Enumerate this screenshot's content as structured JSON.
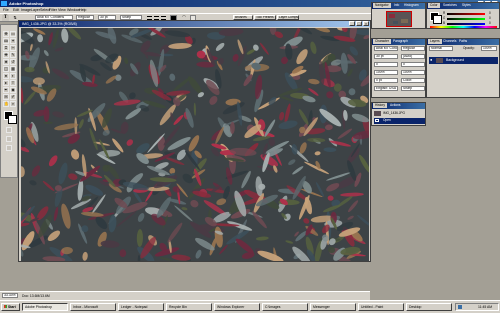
{
  "app": {
    "title": "Adobe Photoshop"
  },
  "menus": [
    "File",
    "Edit",
    "Image",
    "Layer",
    "Select",
    "Filter",
    "View",
    "Window",
    "Help"
  ],
  "options": {
    "font_family": "Arial MT Condens",
    "font_style": "Regular",
    "font_size": "30 pt",
    "antialias": "Sharp",
    "palette_buttons": [
      "Brushes",
      "Tool Presets",
      "Layer Comps"
    ]
  },
  "document": {
    "title": "IMG_1436.JPG @ 33.3% (RGB/8)"
  },
  "status": {
    "zoom": "33.33%",
    "doc_size": "Doc: 13.6M/13.6M"
  },
  "navigator": {
    "tabs": [
      "Navigator",
      "Info",
      "Histogram"
    ],
    "zoom": "33.33%"
  },
  "color_panel": {
    "tabs": [
      "Color",
      "Swatches",
      "Styles"
    ],
    "channels": [
      "R",
      "G",
      "B"
    ],
    "values": [
      "0",
      "0",
      "0"
    ]
  },
  "character": {
    "tabs": [
      "Character",
      "Paragraph"
    ],
    "rows": [
      {
        "a": "Arial MT Condens",
        "b": "Regular"
      },
      {
        "a": "30 pt",
        "b": "(Auto)"
      },
      {
        "a": "0",
        "b": "0"
      },
      {
        "a": "100%",
        "b": "100%"
      },
      {
        "a": "0 pt",
        "b": "Color:"
      },
      {
        "a": "English: USA",
        "b": "Sharp"
      }
    ]
  },
  "layers": {
    "tabs": [
      "Layers",
      "Channels",
      "Paths"
    ],
    "mode": "Normal",
    "opacity_label": "Opacity:",
    "opacity": "100%",
    "items": [
      "Background"
    ]
  },
  "history": {
    "tabs": [
      "History",
      "Actions"
    ],
    "items": [
      "IMG_1436.JPG",
      "Open"
    ]
  },
  "taskbar": {
    "start": "Start",
    "tasks": [
      "Adobe Photoshop",
      "Inbox - Microsoft",
      "Ledger - Notepad",
      "Recycle Bin",
      "Windows Explorer",
      "C:\\Images",
      "Messenger",
      "Untitled - Paint",
      "Desktop"
    ],
    "clock": "11:45 AM"
  },
  "colors": {
    "title_blue": "#0a246a",
    "chrome": "#d4d0c8",
    "workspace": "#a39f95",
    "selection": "#0a246a"
  }
}
